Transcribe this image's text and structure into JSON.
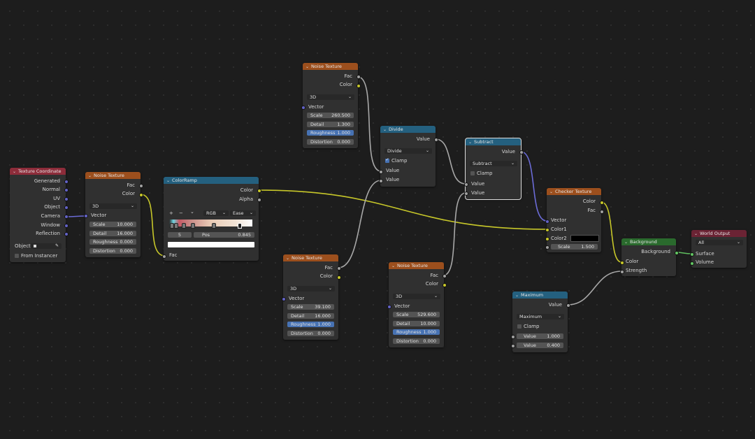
{
  "colors": {
    "texture_header": "#9c4f1d",
    "input_header": "#8d2c3a",
    "converter_header": "#24607f",
    "shader_header": "#2a6a2d",
    "output_header": "#6b2334",
    "socket_grey": "#a1a1a1",
    "socket_yellow": "#c7c729",
    "socket_blue": "#6363c7",
    "socket_green": "#63c763",
    "wire_yellow": "#c7c729",
    "wire_grey": "#a8a8a8",
    "wire_blue": "#6b6bd6",
    "wire_green": "#5fbf5f"
  },
  "icons": {
    "collapse": "chevron-down-icon",
    "eyedropper": "eyedropper-icon",
    "dropdown": "chevron-down-icon"
  },
  "texcoord": {
    "title": "Texture Coordinate",
    "outputs": [
      "Generated",
      "Normal",
      "UV",
      "Object",
      "Camera",
      "Window",
      "Reflection"
    ],
    "object_label": "Object:",
    "from_instancer": "From Instancer"
  },
  "noise_main": {
    "title": "Noise Texture",
    "out_fac": "Fac",
    "out_color": "Color",
    "dim": "3D",
    "vector": "Vector",
    "scale_label": "Scale",
    "scale": "10.000",
    "detail_label": "Detail",
    "detail": "16.000",
    "rough_label": "Roughness",
    "rough": "0.000",
    "dist_label": "Distortion",
    "dist": "0.000"
  },
  "colorramp": {
    "title": "ColorRamp",
    "out_color": "Color",
    "out_alpha": "Alpha",
    "plus": "+",
    "minus": "−",
    "menu": "⌄",
    "mode": "RGB",
    "interp": "Ease",
    "index": "5",
    "pos_label": "Pos",
    "pos": "0.845",
    "in_fac": "Fac",
    "stops": [
      0.03,
      0.08,
      0.17,
      0.28,
      0.53,
      0.845
    ]
  },
  "noise_top": {
    "title": "Noise Texture",
    "out_fac": "Fac",
    "out_color": "Color",
    "dim": "3D",
    "vector": "Vector",
    "scale_label": "Scale",
    "scale": "260.500",
    "detail_label": "Detail",
    "detail": "1.300",
    "rough_label": "Roughness",
    "rough": "1.000",
    "dist_label": "Distortion",
    "dist": "0.000"
  },
  "divide": {
    "title": "Divide",
    "out_value": "Value",
    "op": "Divide",
    "clamp_label": "Clamp",
    "clamp": true,
    "in1": "Value",
    "in2": "Value"
  },
  "noise_mid": {
    "title": "Noise Texture",
    "out_fac": "Fac",
    "out_color": "Color",
    "dim": "3D",
    "vector": "Vector",
    "scale_label": "Scale",
    "scale": "39.100",
    "detail_label": "Detail",
    "detail": "16.000",
    "rough_label": "Roughness",
    "rough": "1.000",
    "dist_label": "Distortion",
    "dist": "0.000"
  },
  "noise_right": {
    "title": "Noise Texture",
    "out_fac": "Fac",
    "out_color": "Color",
    "dim": "3D",
    "vector": "Vector",
    "scale_label": "Scale",
    "scale": "529.600",
    "detail_label": "Detail",
    "detail": "10.000",
    "rough_label": "Roughness",
    "rough": "1.000",
    "dist_label": "Distortion",
    "dist": "0.000"
  },
  "subtract": {
    "title": "Subtract",
    "out_value": "Value",
    "op": "Subtract",
    "clamp_label": "Clamp",
    "clamp": false,
    "in1": "Value",
    "in2": "Value"
  },
  "checker": {
    "title": "Checker Texture",
    "out_color": "Color",
    "out_fac": "Fac",
    "vector": "Vector",
    "color1": "Color1",
    "color2": "Color2",
    "scale_label": "Scale",
    "scale": "1.500"
  },
  "maximum": {
    "title": "Maximum",
    "out_value": "Value",
    "op": "Maximum",
    "clamp_label": "Clamp",
    "clamp": false,
    "v1_label": "Value",
    "v1": "1.000",
    "v2_label": "Value",
    "v2": "0.400"
  },
  "background": {
    "title": "Background",
    "out_bg": "Background",
    "in_color": "Color",
    "in_strength": "Strength"
  },
  "world_output": {
    "title": "World Output",
    "target": "All",
    "surface": "Surface",
    "volume": "Volume"
  }
}
